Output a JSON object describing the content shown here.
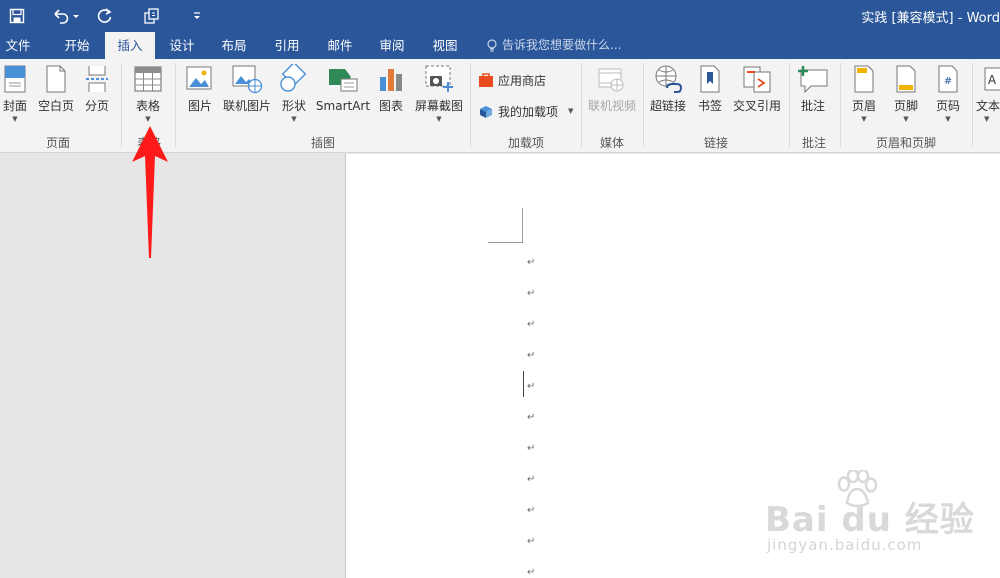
{
  "window": {
    "title": "实践 [兼容模式] - Word"
  },
  "quick_access": {
    "save_icon": "save-icon",
    "undo_icon": "undo-icon",
    "redo_icon": "redo-icon",
    "touch_icon": "touch-mode-icon",
    "customize_icon": "customize-qat-icon"
  },
  "tabs": [
    {
      "label": "文件"
    },
    {
      "label": "开始"
    },
    {
      "label": "插入"
    },
    {
      "label": "设计"
    },
    {
      "label": "布局"
    },
    {
      "label": "引用"
    },
    {
      "label": "邮件"
    },
    {
      "label": "审阅"
    },
    {
      "label": "视图"
    }
  ],
  "tell_me": {
    "placeholder": "告诉我您想要做什么..."
  },
  "ribbon": {
    "pages": {
      "cover": "封面",
      "blank": "空白页",
      "break": "分页",
      "group": "页面"
    },
    "tables": {
      "table": "表格",
      "group": "表格"
    },
    "illustrations": {
      "picture": "图片",
      "online_picture": "联机图片",
      "shapes": "形状",
      "smartart": "SmartArt",
      "chart": "图表",
      "screenshot": "屏幕截图",
      "group": "插图"
    },
    "addins": {
      "store": "应用商店",
      "my_addins": "我的加载项",
      "group": "加载项"
    },
    "media": {
      "online_video": "联机视频",
      "group": "媒体"
    },
    "links": {
      "hyperlink": "超链接",
      "bookmark": "书签",
      "cross_ref": "交叉引用",
      "group": "链接"
    },
    "comments": {
      "comment": "批注",
      "group": "批注"
    },
    "header_footer": {
      "header": "页眉",
      "footer": "页脚",
      "page_number": "页码",
      "group": "页眉和页脚"
    },
    "text": {
      "textbox": "文本"
    }
  },
  "document": {
    "paragraph_mark": "↵"
  },
  "watermark": {
    "brand": "Bai du 经验",
    "url": "jingyan.baidu.com"
  },
  "colors": {
    "accent": "#2b579a",
    "ribbon_bg": "#f3f3f3",
    "arrow": "#ff1a1a"
  }
}
